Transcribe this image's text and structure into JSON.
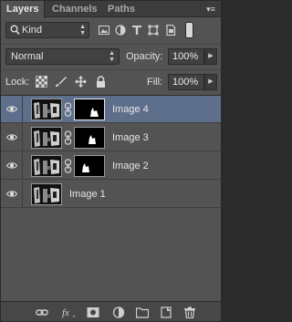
{
  "tabs": [
    {
      "label": "Layers",
      "active": true
    },
    {
      "label": "Channels",
      "active": false
    },
    {
      "label": "Paths",
      "active": false
    }
  ],
  "filter": {
    "kind_label": "Kind",
    "icons": [
      "pixel-filter-icon",
      "adjustment-filter-icon",
      "type-filter-icon",
      "shape-filter-icon",
      "smart-object-filter-icon"
    ]
  },
  "blend": {
    "mode": "Normal",
    "opacity_label": "Opacity:",
    "opacity_value": "100%"
  },
  "lock": {
    "label": "Lock:",
    "icons": [
      "lock-transparent-icon",
      "lock-image-icon",
      "lock-position-icon",
      "lock-all-icon"
    ],
    "fill_label": "Fill:",
    "fill_value": "100%"
  },
  "layers": [
    {
      "name": "Image 4",
      "visible": true,
      "selected": true,
      "has_mask": true
    },
    {
      "name": "Image 3",
      "visible": true,
      "selected": false,
      "has_mask": true
    },
    {
      "name": "Image 2",
      "visible": true,
      "selected": false,
      "has_mask": true
    },
    {
      "name": "Image 1",
      "visible": true,
      "selected": false,
      "has_mask": false
    }
  ],
  "bottom_icons": [
    "link-layers-icon",
    "fx-icon",
    "add-mask-icon",
    "adjustment-layer-icon",
    "new-group-icon",
    "new-layer-icon",
    "delete-layer-icon"
  ],
  "colors": {
    "panel_bg": "#535353",
    "selected_row": "#5e6f8c",
    "tab_bar": "#3c3c3c"
  }
}
